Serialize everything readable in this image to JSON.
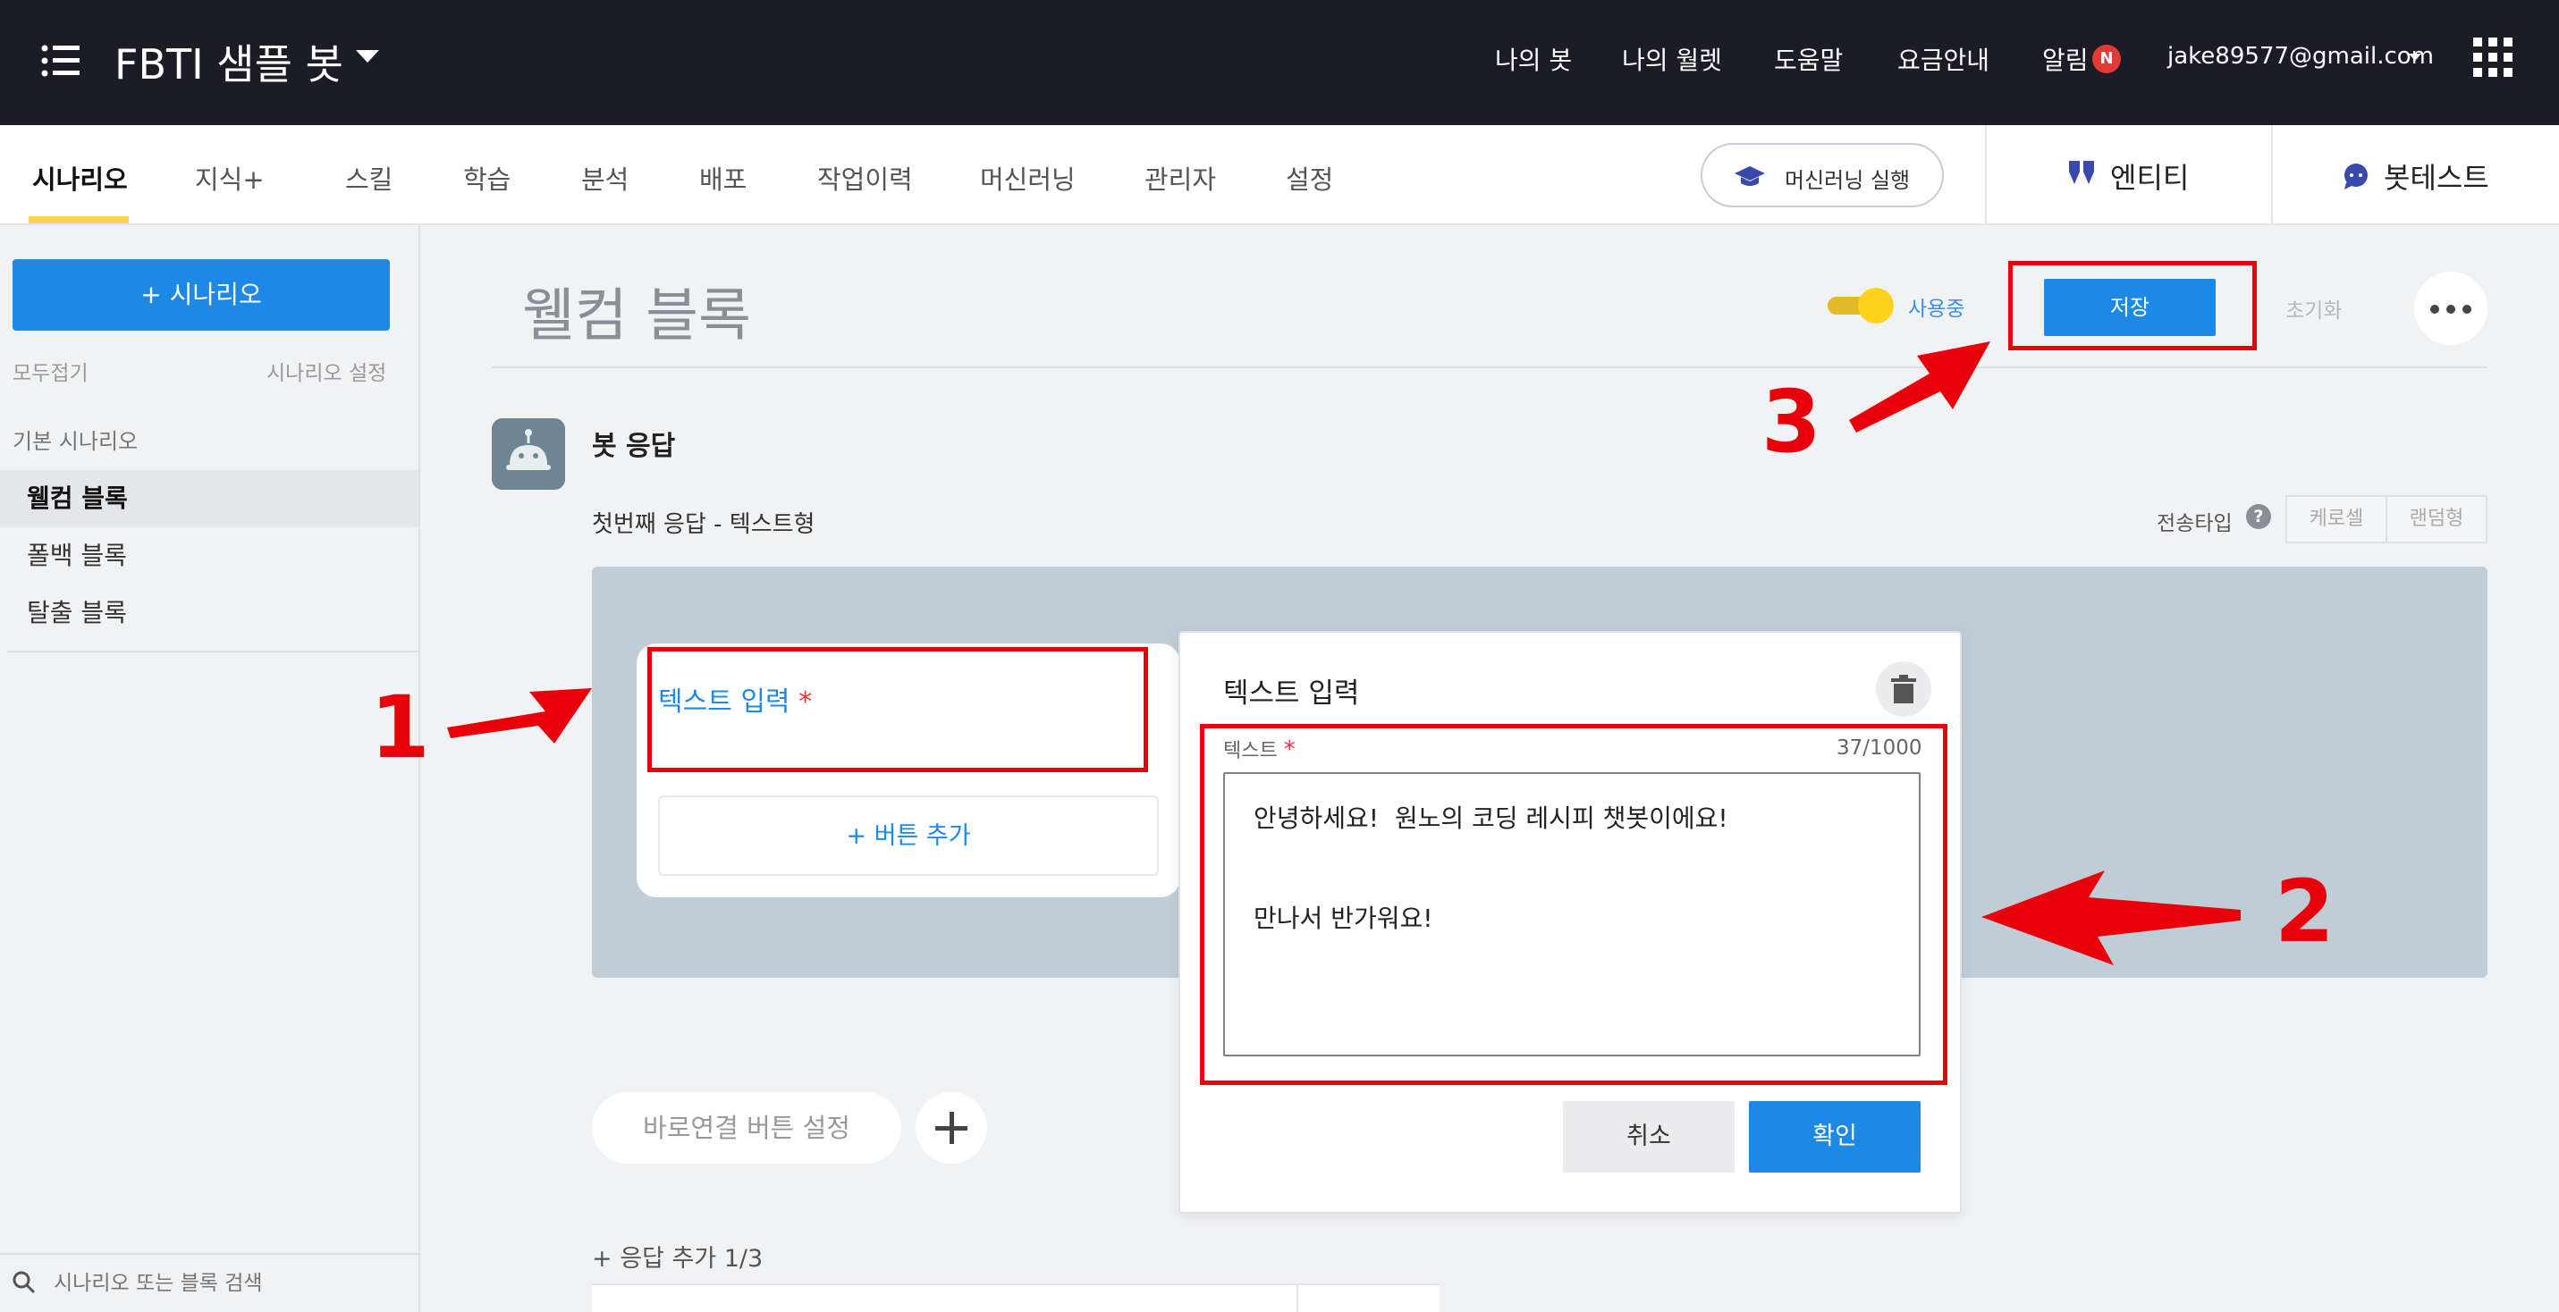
{
  "topbar": {
    "bot_title": "FBTI 샘플 봇",
    "nav": [
      "나의 봇",
      "나의 월렛",
      "도움말",
      "요금안내",
      "알림"
    ],
    "badge": "N",
    "email": "jake89577@gmail.com"
  },
  "subnav": {
    "tabs": [
      "시나리오",
      "지식+",
      "스킬",
      "학습",
      "분석",
      "배포",
      "작업이력",
      "머신러닝",
      "관리자",
      "설정"
    ],
    "ml_button": "머신러닝 실행",
    "entity": "엔티티",
    "bottest": "봇테스트"
  },
  "sidebar": {
    "add_button": "+ 시나리오",
    "collapse_all": "모두접기",
    "scenario_settings": "시나리오 설정",
    "section_title": "기본 시나리오",
    "items": [
      "웰컴 블록",
      "폴백 블록",
      "탈출 블록"
    ],
    "search_placeholder": "시나리오 또는 블록 검색"
  },
  "main": {
    "title": "웰컴 블록",
    "toggle_label": "사용중",
    "save": "저장",
    "reset": "초기화",
    "bot_response": "봇 응답",
    "response_subtitle": "첫번째 응답 - 텍스트형",
    "send_type": "전송타입",
    "help": "?",
    "send_types": [
      "케로셀",
      "랜덤형"
    ],
    "card_label": "텍스트 입력",
    "required_mark": "*",
    "add_button": "+ 버튼 추가",
    "quick_reply": "바로연결 버튼 설정",
    "add_response": "+ 응답 추가 1/3"
  },
  "panel": {
    "title": "텍스트 입력",
    "field_label": "텍스트",
    "counter": "37/1000",
    "text": "안녕하세요!  원노의 코딩 레시피 챗봇이에요!\n\n만나서 반가워요!",
    "cancel": "취소",
    "confirm": "확인"
  },
  "annotations": [
    "1",
    "2",
    "3"
  ],
  "colors": {
    "topbar": "#1b1c26",
    "accent": "#1e88e5",
    "highlight": "#e8000b",
    "toggle": "#ffd21e"
  }
}
